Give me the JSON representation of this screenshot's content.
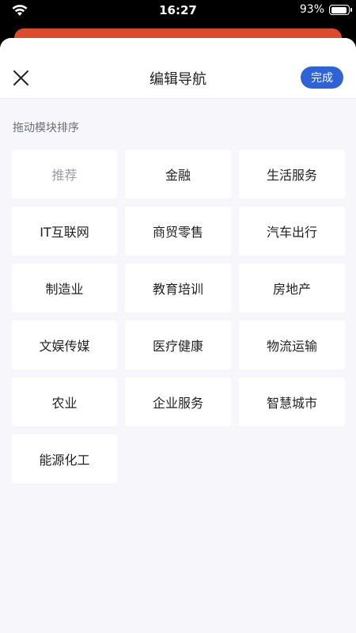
{
  "status_bar": {
    "time": "16:27",
    "battery_percent": "93%",
    "battery_level": 0.93,
    "icons": [
      "wifi-icon",
      "battery-icon"
    ]
  },
  "header": {
    "close_icon": "close-icon",
    "title": "编辑导航",
    "done_label": "完成"
  },
  "section": {
    "label": "拖动模块排序"
  },
  "modules": [
    {
      "label": "推荐",
      "fixed": true
    },
    {
      "label": "金融",
      "fixed": false
    },
    {
      "label": "生活服务",
      "fixed": false
    },
    {
      "label": "IT互联网",
      "fixed": false
    },
    {
      "label": "商贸零售",
      "fixed": false
    },
    {
      "label": "汽车出行",
      "fixed": false
    },
    {
      "label": "制造业",
      "fixed": false
    },
    {
      "label": "教育培训",
      "fixed": false
    },
    {
      "label": "房地产",
      "fixed": false
    },
    {
      "label": "文娱传媒",
      "fixed": false
    },
    {
      "label": "医疗健康",
      "fixed": false
    },
    {
      "label": "物流运输",
      "fixed": false
    },
    {
      "label": "农业",
      "fixed": false
    },
    {
      "label": "企业服务",
      "fixed": false
    },
    {
      "label": "智慧城市",
      "fixed": false
    },
    {
      "label": "能源化工",
      "fixed": false
    }
  ],
  "colors": {
    "accent": "#2d63d6",
    "background_strip": "#dd4b2c",
    "sheet_background": "#f6f6fb",
    "disabled_text": "#9b9ea4"
  }
}
